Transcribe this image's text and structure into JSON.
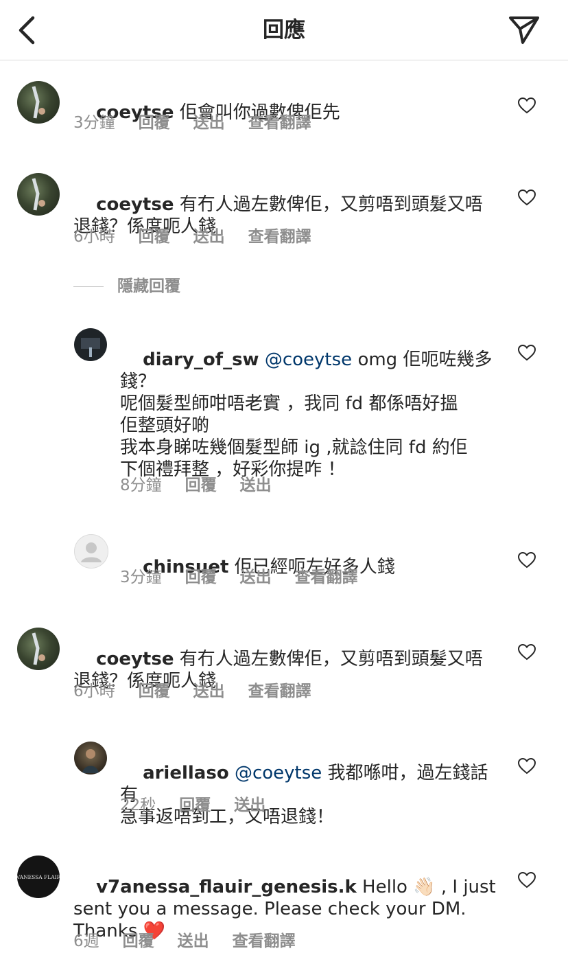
{
  "header": {
    "title": "回應"
  },
  "hide_replies_label": "隱藏回覆",
  "action_labels": {
    "reply": "回覆",
    "send": "送出",
    "translate": "查看翻譯"
  },
  "comments": [
    {
      "username": "coeytse",
      "mention": "",
      "text": "佢會叫你過數俾佢先",
      "time": "3分鐘",
      "show_translate": true
    },
    {
      "username": "coeytse",
      "mention": "",
      "text": "有冇人過左數俾佢，又剪唔到頭髮又唔\n退錢？係度呃人錢",
      "time": "6小時",
      "show_translate": true
    },
    {
      "username": "diary_of_sw",
      "mention": "@coeytse",
      "text": "omg 佢呃咗幾多\n錢？\n呢個髮型師咁唔老實 ，我同 fd 都係唔好搵\n佢整頭好啲\n我本身睇咗幾個髮型師 ig ,就諗住同 fd 約佢\n下個禮拜整 ，好彩你提咋 ！",
      "time": "8分鐘",
      "show_translate": false
    },
    {
      "username": "chinsuet",
      "mention": "",
      "text": "佢已經呃左好多人錢",
      "time": "3分鐘",
      "show_translate": true
    },
    {
      "username": "coeytse",
      "mention": "",
      "text": "有冇人過左數俾佢，又剪唔到頭髮又唔\n退錢？係度呃人錢",
      "time": "6小時",
      "show_translate": true
    },
    {
      "username": "ariellaso",
      "mention": "@coeytse",
      "text": "我都喺咁，過左錢話有\n急事返唔到工，又唔退錢！",
      "time": "22秒",
      "show_translate": false
    },
    {
      "username": "v7anessa_flauir_genesis.k",
      "mention": "",
      "text": "Hello 👋🏻 , I just\nsent you a message. Please check your DM.\nThanks ❤️",
      "time": "6週",
      "show_translate": true
    }
  ],
  "avatar_logo_text": "VANESSA FLAIR",
  "colors": {
    "mention": "#00376b",
    "meta": "#8e8e8e",
    "heart_outline": "#262626",
    "divider": "#dbdbdb"
  }
}
